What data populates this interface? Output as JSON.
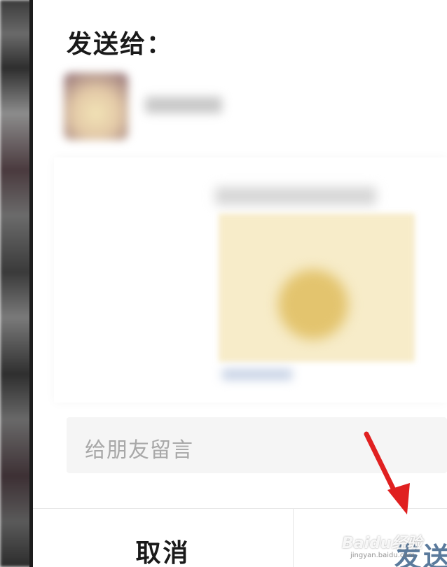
{
  "dialog": {
    "title": "发送给：",
    "message_placeholder": "给朋友留言",
    "cancel_label": "取消",
    "send_label": "发送"
  },
  "colors": {
    "send_text": "#5a7a9c",
    "annotation_arrow": "#e02020"
  },
  "watermark": {
    "brand": "Baidu经验",
    "domain": "jingyan.baidu.com"
  }
}
